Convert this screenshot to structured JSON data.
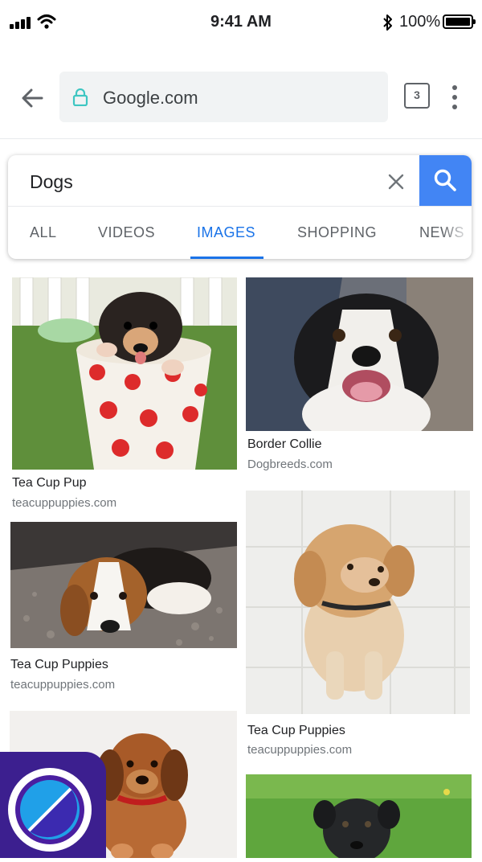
{
  "status_bar": {
    "time": "9:41 AM",
    "battery_percent": "100%",
    "battery_level": 1.0,
    "icons": [
      "signal-icon",
      "wifi-icon",
      "bluetooth-icon",
      "battery-icon"
    ]
  },
  "browser": {
    "url": "Google.com",
    "tab_count": "3",
    "icons": [
      "back-arrow-icon",
      "lock-icon",
      "tabs-icon",
      "more-vert-icon"
    ]
  },
  "search": {
    "query": "Dogs",
    "tabs": [
      {
        "label": "ALL",
        "active": false
      },
      {
        "label": "VIDEOS",
        "active": false
      },
      {
        "label": "IMAGES",
        "active": true
      },
      {
        "label": "SHOPPING",
        "active": false
      },
      {
        "label": "NEWS",
        "active": false
      }
    ],
    "accent_color": "#1a73e8",
    "search_button_color": "#4285f4"
  },
  "results": [
    {
      "title": "Tea Cup Pup",
      "source": "teacuppuppies.com",
      "image": "puppy-in-polka-dot-cup"
    },
    {
      "title": "Border Collie",
      "source": "Dogbreeds.com",
      "image": "border-collie-face"
    },
    {
      "title": "Tea Cup Puppies",
      "source": "teacuppuppies.com",
      "image": "beagle-puppy-on-gravel"
    },
    {
      "title": "Tea Cup Puppies",
      "source": "teacuppuppies.com",
      "image": "golden-puppy-on-tiles"
    },
    {
      "title": "",
      "source": "",
      "image": "brown-puppy-red-collar"
    },
    {
      "title": "",
      "source": "",
      "image": "black-puppy-on-grass"
    }
  ],
  "app_badge": {
    "icon": "app-logo-icon",
    "color": "#3c1f8f"
  }
}
